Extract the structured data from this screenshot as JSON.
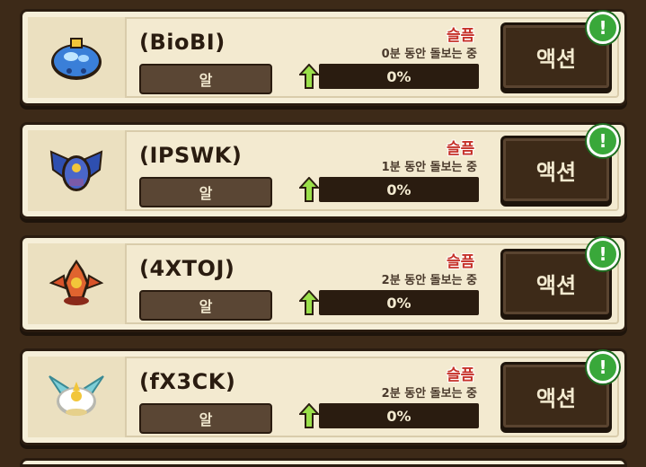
{
  "pets": [
    {
      "name": "(BioBI)",
      "type_label": "알",
      "status": "슬픔",
      "care_text": "0분 동안 돌보는 중",
      "progress_text": "0%",
      "progress": 0,
      "action_label": "액션",
      "alert": "!",
      "icon": "blue-egg-pet-icon",
      "color": "#3a7fd8"
    },
    {
      "name": "(IPSWK)",
      "type_label": "알",
      "status": "슬픔",
      "care_text": "1분 동안 돌보는 중",
      "progress_text": "0%",
      "progress": 0,
      "action_label": "액션",
      "alert": "!",
      "icon": "blue-winged-pet-icon",
      "color": "#2e4fb0"
    },
    {
      "name": "(4XTOJ)",
      "type_label": "알",
      "status": "슬픔",
      "care_text": "2분 동안 돌보는 중",
      "progress_text": "0%",
      "progress": 0,
      "action_label": "액션",
      "alert": "!",
      "icon": "fire-egg-pet-icon",
      "color": "#d8532a"
    },
    {
      "name": "(fX3CK)",
      "type_label": "알",
      "status": "슬픔",
      "care_text": "2분 동안 돌보는 중",
      "progress_text": "0%",
      "progress": 0,
      "action_label": "액션",
      "alert": "!",
      "icon": "light-winged-pet-icon",
      "color": "#7ecfd8"
    }
  ]
}
